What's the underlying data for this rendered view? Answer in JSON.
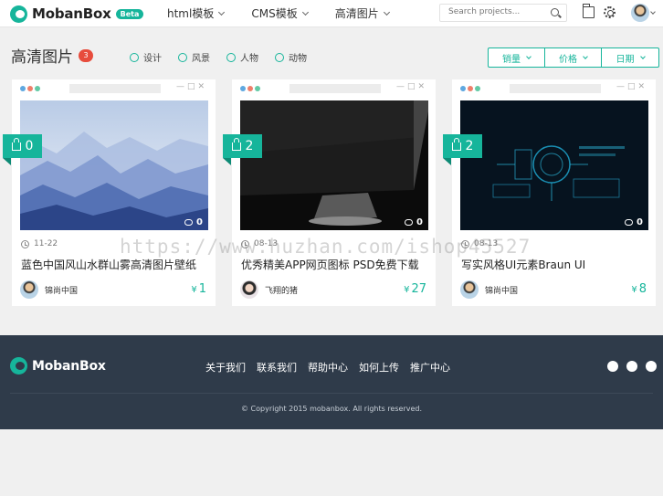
{
  "brand": {
    "name": "MobanBox",
    "badge": "Beta",
    "accent": "#16b59b"
  },
  "nav": [
    {
      "label": "html模板"
    },
    {
      "label": "CMS模板"
    },
    {
      "label": "高清图片"
    }
  ],
  "search": {
    "placeholder": "Search projects...",
    "icon": "search-icon"
  },
  "header_icons": [
    "folder-icon",
    "gear-icon",
    "avatar"
  ],
  "page": {
    "title": "高清图片",
    "count": "3"
  },
  "filters": [
    {
      "label": "设计"
    },
    {
      "label": "风景"
    },
    {
      "label": "人物"
    },
    {
      "label": "动物"
    }
  ],
  "sort": [
    {
      "label": "销量"
    },
    {
      "label": "价格"
    },
    {
      "label": "日期"
    }
  ],
  "cards": [
    {
      "likes": "0",
      "comments": "0",
      "date": "11-22",
      "title": "蓝色中国风山水群山雾高清图片壁纸",
      "author": "锦尚中国",
      "price_symbol": "¥",
      "price": "1"
    },
    {
      "likes": "2",
      "comments": "0",
      "date": "08-13",
      "title": "优秀精美APP网页图标 PSD免费下载",
      "author": "飞翔的猪",
      "price_symbol": "¥",
      "price": "27"
    },
    {
      "likes": "2",
      "comments": "0",
      "date": "08-13",
      "title": "写实风格UI元素Braun UI",
      "author": "锦尚中国",
      "price_symbol": "¥",
      "price": "8"
    }
  ],
  "footer": {
    "brand": "MobanBox",
    "links": [
      {
        "label": "关于我们"
      },
      {
        "label": "联系我们"
      },
      {
        "label": "帮助中心"
      },
      {
        "label": "如何上传"
      },
      {
        "label": "推广中心"
      }
    ],
    "social_icons": [
      "wechat-icon",
      "weibo-icon",
      "qq-icon"
    ],
    "copyright": "© Copyright 2015 mobanbox. All rights reserved."
  },
  "watermark": "https://www.huzhan.com/ishop45527"
}
